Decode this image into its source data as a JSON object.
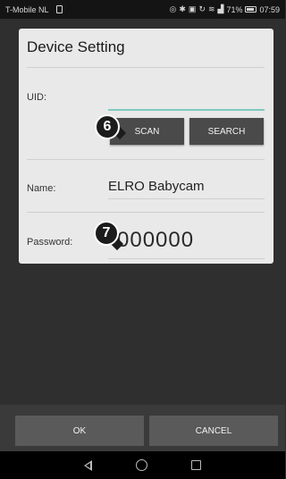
{
  "status_bar": {
    "carrier": "T-Mobile NL",
    "battery": "71%",
    "time": "07:59"
  },
  "dialog": {
    "title": "Device Setting",
    "uid_label": "UID:",
    "uid_value": "",
    "scan_button": "SCAN",
    "search_button": "SEARCH",
    "name_label": "Name:",
    "name_value": "ELRO Babycam",
    "password_label": "Password:",
    "password_value": "000000"
  },
  "callouts": {
    "scan_marker": "6",
    "password_marker": "7"
  },
  "actions": {
    "ok": "OK",
    "cancel": "CANCEL"
  }
}
